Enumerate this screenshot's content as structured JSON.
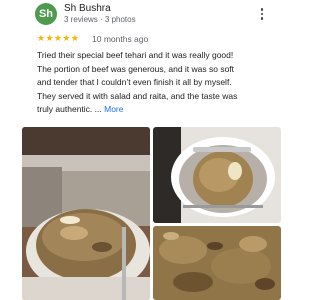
{
  "review": {
    "author": {
      "initials": "Sh",
      "name": "Sh Bushra",
      "meta": "3 reviews · 3 photos",
      "avatar_color": "#4e9a4f"
    },
    "rating": 5,
    "stars": "★★★★★",
    "date": "10 months ago",
    "text_lines": [
      "Tried their special beef tehari and it was really good!",
      "The portion of beef was generous, and it was so soft",
      "and tender that I couldn’t even finish it all by myself.",
      "They served it with salad and raita, and the taste was"
    ],
    "text_last": "truly authentic. ...",
    "more_label": "More",
    "menu_icon": "more-vert-icon",
    "photos": [
      "tehari-plate-photo",
      "tehari-mound-photo",
      "tehari-closeup-photo"
    ]
  },
  "colors": {
    "star": "#f4b400",
    "link": "#1a73e8",
    "secondary_text": "#5f6368"
  }
}
